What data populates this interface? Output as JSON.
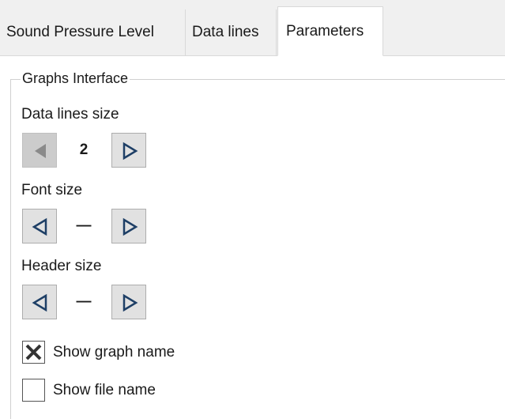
{
  "tabs": [
    {
      "label": "Sound Pressure Level",
      "active": false
    },
    {
      "label": "Data lines",
      "active": false
    },
    {
      "label": "Parameters",
      "active": true
    }
  ],
  "group": {
    "title": "Graphs Interface",
    "data_lines_size": {
      "label": "Data lines size",
      "value": "2",
      "decrease_enabled": false,
      "increase_enabled": true
    },
    "font_size": {
      "label": "Font size",
      "value": "—",
      "decrease_enabled": true,
      "increase_enabled": true
    },
    "header_size": {
      "label": "Header size",
      "value": "—",
      "decrease_enabled": true,
      "increase_enabled": true
    },
    "show_graph_name": {
      "label": "Show graph name",
      "checked": true
    },
    "show_file_name": {
      "label": "Show file name",
      "checked": false
    }
  },
  "icons": {
    "decrease": "arrow-left-icon",
    "increase": "arrow-right-icon",
    "check": "x-check-icon"
  },
  "colors": {
    "arrow_enabled": "#1e3f66",
    "arrow_disabled": "#8a8a8a"
  }
}
